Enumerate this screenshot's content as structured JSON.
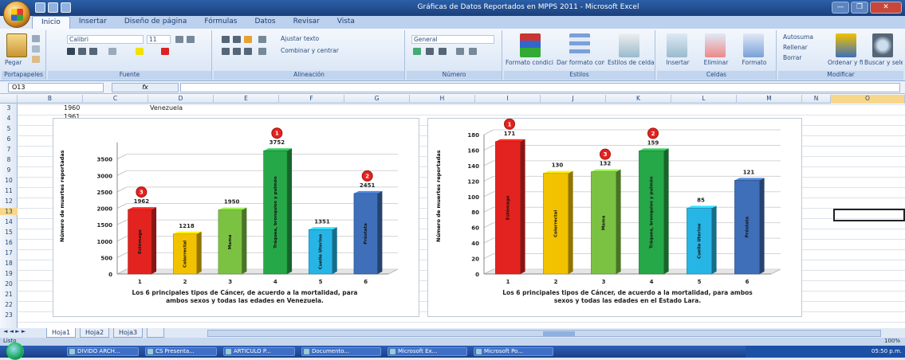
{
  "window": {
    "title": "Gráficas de Datos Reportados en MPPS 2011 - Microsoft Excel",
    "controls": [
      "—",
      "❐",
      "✕"
    ]
  },
  "ribbon_tabs": [
    "Inicio",
    "Insertar",
    "Diseño de página",
    "Fórmulas",
    "Datos",
    "Revisar",
    "Vista"
  ],
  "ribbon": {
    "clipboard": {
      "paste": "Pegar",
      "label": "Portapapeles"
    },
    "font": {
      "name": "Calibri",
      "size": "11",
      "label": "Fuente"
    },
    "alignment": {
      "wrap": "Ajustar texto",
      "merge": "Combinar y centrar",
      "label": "Alineación"
    },
    "number": {
      "format": "General",
      "label": "Número"
    },
    "styles": {
      "conditional": "Formato condicional",
      "table": "Dar formato como tabla",
      "cell_styles": "Estilos de celda",
      "label": "Estilos"
    },
    "cells": {
      "insert": "Insertar",
      "delete": "Eliminar",
      "format": "Formato",
      "label": "Celdas"
    },
    "editing": {
      "autosum": "Autosuma",
      "fill": "Rellenar",
      "clear": "Borrar",
      "sort": "Ordenar y filtrar",
      "find": "Buscar y seleccionar",
      "label": "Modificar"
    }
  },
  "formula_bar": {
    "name_box": "O13",
    "fx": "fx",
    "value": ""
  },
  "columns": [
    "B",
    "C",
    "D",
    "E",
    "F",
    "G",
    "H",
    "I",
    "J",
    "K",
    "L",
    "M",
    "N",
    "O"
  ],
  "rows": [
    "3",
    "4",
    "5",
    "6",
    "7",
    "8",
    "9",
    "10",
    "11",
    "12",
    "13",
    "14",
    "15",
    "16",
    "17",
    "18",
    "19",
    "20",
    "21",
    "22",
    "23"
  ],
  "cells": {
    "b3": "1960",
    "d3": "Venezuela",
    "b4": "1961"
  },
  "charts": [
    {
      "ytitle": "Número de muertes reportadas",
      "caption_line1": "Los 6 principales tipos de Cáncer, de acuerdo a la mortalidad, para",
      "caption_line2": "ambos sexos y todas las edades en Venezuela."
    },
    {
      "ytitle": "Número de muertes reportadas",
      "caption_line1": "Los 6 principales tipos de Cáncer, de acuerdo a la mortalidad, para ambos",
      "caption_line2": "sexos y todas las edades en el Estado Lara."
    }
  ],
  "chart_data": [
    {
      "type": "bar",
      "categories": [
        "1",
        "2",
        "3",
        "4",
        "5",
        "6"
      ],
      "values": [
        1962,
        1218,
        1950,
        3752,
        1351,
        2451
      ],
      "bar_labels": [
        "Estómago",
        "Colorrectal",
        "Mama",
        "Tráquea, bronquios y pulmón",
        "Cuello Uterino",
        "Próstata"
      ],
      "colors": [
        "#e3231f",
        "#f2c200",
        "#7cc242",
        "#27a848",
        "#27b5e6",
        "#3e6fb8"
      ],
      "ranks": {
        "0": "3",
        "3": "1",
        "5": "2"
      },
      "yticks": [
        0,
        500,
        1000,
        1500,
        2000,
        2500,
        3000,
        3500
      ],
      "ylim": [
        0,
        4000
      ]
    },
    {
      "type": "bar",
      "categories": [
        "1",
        "2",
        "3",
        "4",
        "5",
        "6"
      ],
      "values": [
        171,
        130,
        132,
        159,
        85,
        121
      ],
      "bar_labels": [
        "Estómago",
        "Colorrectal",
        "Mama",
        "Tráquea, bronquios y pulmón",
        "Cuello Uterino",
        "Próstata"
      ],
      "colors": [
        "#e3231f",
        "#f2c200",
        "#7cc242",
        "#27a848",
        "#27b5e6",
        "#3e6fb8"
      ],
      "ranks": {
        "0": "1",
        "2": "3",
        "3": "2"
      },
      "yticks": [
        0,
        20,
        40,
        60,
        80,
        100,
        120,
        140,
        160,
        180
      ],
      "ylim": [
        0,
        180
      ]
    }
  ],
  "sheet_tabs": [
    "Hoja1",
    "Hoja2",
    "Hoja3"
  ],
  "status": {
    "left": "Listo",
    "zoom": "100%"
  },
  "taskbar": {
    "buttons": [
      "DIVIDO ARCH...",
      "CS Presenta...",
      "ARTÍCULO P...",
      "Documento...",
      "Microsoft Ex...",
      "Microsoft Po..."
    ],
    "clock": "05:50 p.m."
  }
}
